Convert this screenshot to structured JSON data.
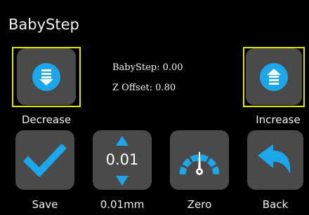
{
  "header": {
    "title": "BabyStep"
  },
  "readouts": {
    "babystep_line": "BabyStep: 0.00",
    "zoffset_line": "Z Offset: 0.80"
  },
  "controls": {
    "decrease_label": "Decrease",
    "increase_label": "Increase",
    "step_value": "0.01",
    "step_label": "0.01mm"
  },
  "toolbar": {
    "save_label": "Save",
    "zero_label": "Zero",
    "back_label": "Back"
  },
  "colors": {
    "accent": "#1aa7ec",
    "highlight": "#e6e600",
    "tile": "#4a4a4a",
    "background": "#000000"
  },
  "icons": {
    "decrease": "arrow-down-icon",
    "increase": "arrow-up-icon",
    "save": "checkmark-icon",
    "step_up": "triangle-up-icon",
    "step_down": "triangle-down-icon",
    "zero": "gauge-icon",
    "back": "back-arrow-icon"
  }
}
